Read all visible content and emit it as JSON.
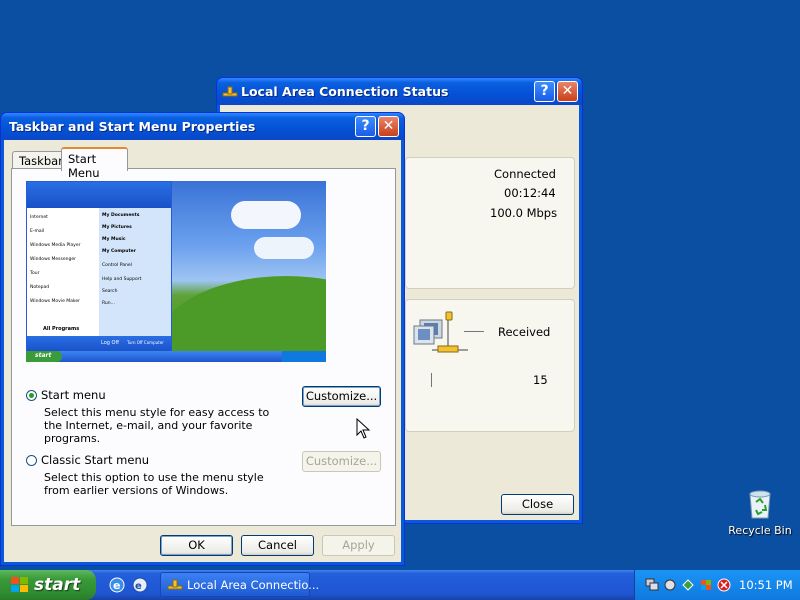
{
  "desktop": {
    "recycle_bin_label": "Recycle Bin"
  },
  "lan_window": {
    "title": "Local Area Connection Status",
    "status": "Connected",
    "duration": "00:12:44",
    "speed": "100.0 Mbps",
    "received_label": "Received",
    "received_value": "15",
    "close_label": "Close"
  },
  "taskbar_window": {
    "title": "Taskbar and Start Menu Properties",
    "tabs": [
      {
        "label": "Taskbar",
        "active": false
      },
      {
        "label": "Start Menu",
        "active": true
      }
    ],
    "preview": {
      "start_label": "start",
      "logoff_label": "Log Off",
      "turnoff_label": "Turn Off Computer",
      "all_programs_label": "All Programs",
      "left_items": [
        "Internet",
        "E-mail",
        "Windows Media Player",
        "Windows Messenger",
        "Tour",
        "Notepad",
        "Windows Movie Maker"
      ],
      "right_items": [
        "My Documents",
        "My Pictures",
        "My Music",
        "My Computer",
        "Control Panel",
        "Help and Support",
        "Search",
        "Run..."
      ]
    },
    "options": [
      {
        "label": "Start menu",
        "selected": true,
        "desc": "Select this menu style for easy access to the Internet, e-mail, and your favorite programs.",
        "button": "Customize...",
        "button_enabled": true
      },
      {
        "label": "Classic Start menu",
        "selected": false,
        "desc": "Select this option to use the menu style from earlier versions of Windows.",
        "button": "Customize...",
        "button_enabled": false
      }
    ],
    "ok_label": "OK",
    "cancel_label": "Cancel",
    "apply_label": "Apply"
  },
  "taskbar": {
    "start_label": "start",
    "active_task": "Local Area Connectio...",
    "clock": "10:51 PM"
  },
  "colors": {
    "desktop_bg": "#0b4fa2",
    "title_blue": "#0451d6",
    "dialog_bg": "#ece9d8",
    "start_green": "#3a9b3a"
  }
}
